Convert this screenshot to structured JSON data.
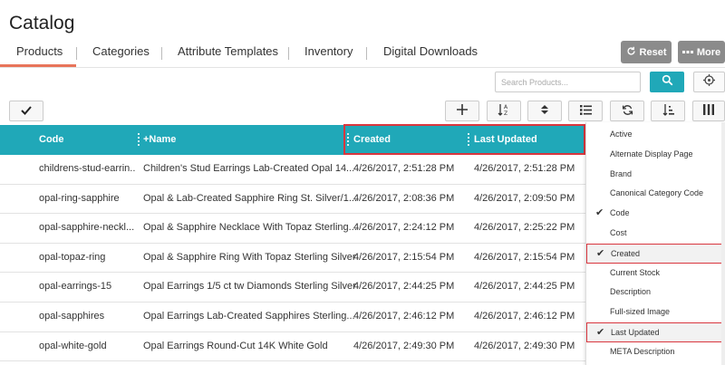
{
  "page": {
    "title": "Catalog"
  },
  "tabs": [
    {
      "label": "Products"
    },
    {
      "label": "Categories"
    },
    {
      "label": "Attribute Templates"
    },
    {
      "label": "Inventory"
    },
    {
      "label": "Digital Downloads"
    }
  ],
  "actions": {
    "reset_label": "Reset",
    "more_label": "More"
  },
  "search": {
    "placeholder": "Search Products..."
  },
  "grid": {
    "columns": [
      {
        "label": "Code"
      },
      {
        "label": "+Name"
      },
      {
        "label": "Created"
      },
      {
        "label": "Last Updated"
      }
    ],
    "rows": [
      {
        "code": "childrens-stud-earrin..",
        "name": "Children's Stud Earrings Lab-Created Opal 14...",
        "created": "4/26/2017, 2:51:28 PM",
        "updated": "4/26/2017, 2:51:28 PM"
      },
      {
        "code": "opal-ring-sapphire",
        "name": "Opal & Lab-Created Sapphire Ring St. Silver/1...",
        "created": "4/26/2017, 2:08:36 PM",
        "updated": "4/26/2017, 2:09:50 PM"
      },
      {
        "code": "opal-sapphire-neckl...",
        "name": "Opal & Sapphire Necklace With Topaz Sterling...",
        "created": "4/26/2017, 2:24:12 PM",
        "updated": "4/26/2017, 2:25:22 PM"
      },
      {
        "code": "opal-topaz-ring",
        "name": "Opal & Sapphire Ring With Topaz Sterling Silver",
        "created": "4/26/2017, 2:15:54 PM",
        "updated": "4/26/2017, 2:15:54 PM"
      },
      {
        "code": "opal-earrings-15",
        "name": "Opal Earrings 1/5 ct tw Diamonds Sterling Silver",
        "created": "4/26/2017, 2:44:25 PM",
        "updated": "4/26/2017, 2:44:25 PM"
      },
      {
        "code": "opal-sapphires",
        "name": "Opal Earrings Lab-Created Sapphires Sterling...",
        "created": "4/26/2017, 2:46:12 PM",
        "updated": "4/26/2017, 2:46:12 PM"
      },
      {
        "code": "opal-white-gold",
        "name": "Opal Earrings Round-Cut 14K White Gold",
        "created": "4/26/2017, 2:49:30 PM",
        "updated": "4/26/2017, 2:49:30 PM"
      }
    ]
  },
  "column_menu": {
    "items": [
      {
        "label": "Active",
        "checked": false
      },
      {
        "label": "Alternate Display Page",
        "checked": false
      },
      {
        "label": "Brand",
        "checked": false
      },
      {
        "label": "Canonical Category Code",
        "checked": false
      },
      {
        "label": "Code",
        "checked": true
      },
      {
        "label": "Cost",
        "checked": false
      },
      {
        "label": "Created",
        "checked": true
      },
      {
        "label": "Current Stock",
        "checked": false
      },
      {
        "label": "Description",
        "checked": false
      },
      {
        "label": "Full-sized Image",
        "checked": false
      },
      {
        "label": "Last Updated",
        "checked": true
      },
      {
        "label": "META Description",
        "checked": false
      }
    ]
  },
  "colors": {
    "accent": "#20a8b8",
    "tab_underline": "#e8745a",
    "highlight": "#d9363e",
    "button_gray": "#8b8b8b"
  },
  "icons": {
    "reset": "refresh-icon",
    "more": "dots-icon",
    "search": "magnifier-icon",
    "target": "target-icon",
    "select_all": "check-icon",
    "add": "plus-icon",
    "sort_az": "sort-az-icon",
    "sort": "sort-arrows-icon",
    "list": "list-icon",
    "refresh": "refresh-icon",
    "sort_desc": "sort-desc-icon",
    "columns": "columns-icon"
  }
}
